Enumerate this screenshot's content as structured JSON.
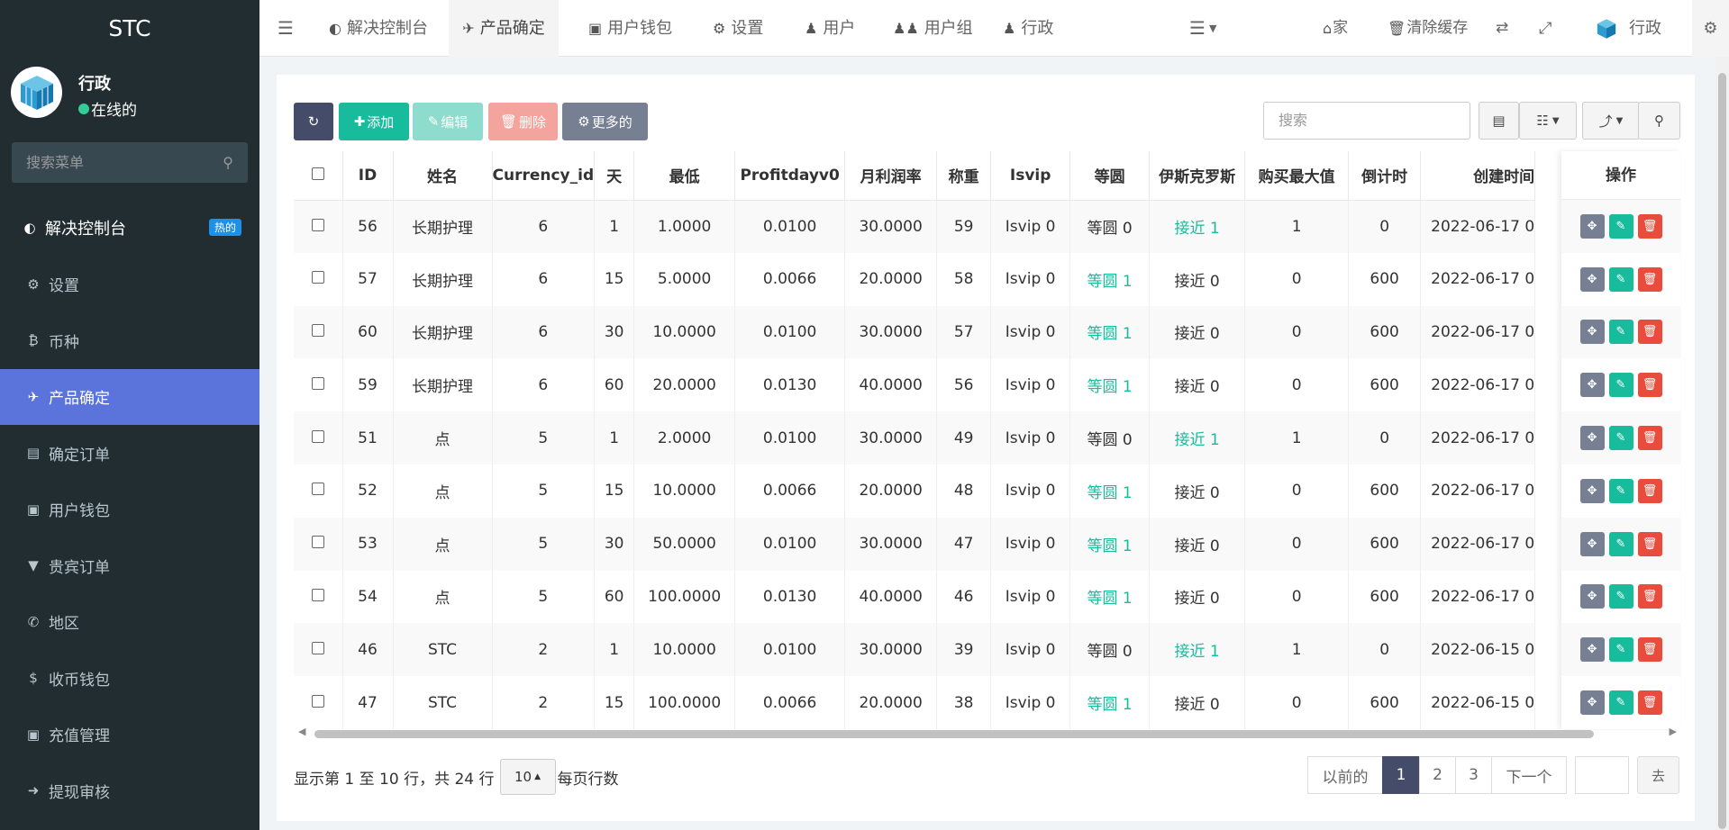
{
  "app": {
    "logo": "STC",
    "user_name": "行政",
    "user_status": "在线的",
    "search_placeholder": "搜索菜单"
  },
  "sidebar": {
    "items": [
      {
        "label": "解决控制台",
        "icon": "dashboard-icon",
        "badge": "热的"
      },
      {
        "label": "设置",
        "icon": "gear-icon"
      },
      {
        "label": "币种",
        "icon": "bitcoin-icon"
      },
      {
        "label": "产品确定",
        "icon": "plane-icon",
        "active": true
      },
      {
        "label": "确定订单",
        "icon": "book-icon"
      },
      {
        "label": "用户钱包",
        "icon": "money-icon"
      },
      {
        "label": "贵宾订单",
        "icon": "chevron-circle-icon"
      },
      {
        "label": "地区",
        "icon": "phone-square-icon"
      },
      {
        "label": "收币钱包",
        "icon": "dollar-icon"
      },
      {
        "label": "充值管理",
        "icon": "money-icon"
      },
      {
        "label": "提现审核",
        "icon": "arrow-circle-icon"
      }
    ]
  },
  "header": {
    "tabs": [
      {
        "label": "解决控制台",
        "icon": "dashboard-icon"
      },
      {
        "label": "产品确定",
        "icon": "plane-icon"
      },
      {
        "label": "用户钱包",
        "icon": "money-icon"
      },
      {
        "label": "设置",
        "icon": "gear-icon"
      },
      {
        "label": "用户",
        "icon": "user-icon"
      },
      {
        "label": "用户组",
        "icon": "users-icon"
      },
      {
        "label": "行政",
        "icon": "user-icon"
      }
    ],
    "home": "家",
    "clear_cache": "清除缓存",
    "admin": "行政"
  },
  "toolbar": {
    "add": "添加",
    "edit": "编辑",
    "delete": "删除",
    "more": "更多的",
    "search_placeholder": "搜索"
  },
  "table": {
    "columns": [
      "ID",
      "姓名",
      "Currency_id",
      "天",
      "最低",
      "Profitdayv0",
      "月利润率",
      "称重",
      "Isvip",
      "等圆",
      "伊斯克罗斯",
      "购买最大值",
      "倒计时",
      "创建时间",
      "操作"
    ],
    "rows": [
      {
        "id": "56",
        "name": "长期护理",
        "cur": "6",
        "day": "1",
        "min": "1.0000",
        "pd": "0.0100",
        "mr": "30.0000",
        "w": "59",
        "vip": "Isvip 0",
        "dy": "等圆 0",
        "ys": "接近 1",
        "max": "1",
        "cd": "0",
        "ct": "2022-06-17 0"
      },
      {
        "id": "57",
        "name": "长期护理",
        "cur": "6",
        "day": "15",
        "min": "5.0000",
        "pd": "0.0066",
        "mr": "20.0000",
        "w": "58",
        "vip": "Isvip 0",
        "dy": "等圆 1",
        "ys": "接近 0",
        "max": "0",
        "cd": "600",
        "ct": "2022-06-17 0"
      },
      {
        "id": "60",
        "name": "长期护理",
        "cur": "6",
        "day": "30",
        "min": "10.0000",
        "pd": "0.0100",
        "mr": "30.0000",
        "w": "57",
        "vip": "Isvip 0",
        "dy": "等圆 1",
        "ys": "接近 0",
        "max": "0",
        "cd": "600",
        "ct": "2022-06-17 0"
      },
      {
        "id": "59",
        "name": "长期护理",
        "cur": "6",
        "day": "60",
        "min": "20.0000",
        "pd": "0.0130",
        "mr": "40.0000",
        "w": "56",
        "vip": "Isvip 0",
        "dy": "等圆 1",
        "ys": "接近 0",
        "max": "0",
        "cd": "600",
        "ct": "2022-06-17 0"
      },
      {
        "id": "51",
        "name": "点",
        "cur": "5",
        "day": "1",
        "min": "2.0000",
        "pd": "0.0100",
        "mr": "30.0000",
        "w": "49",
        "vip": "Isvip 0",
        "dy": "等圆 0",
        "ys": "接近 1",
        "max": "1",
        "cd": "0",
        "ct": "2022-06-17 0"
      },
      {
        "id": "52",
        "name": "点",
        "cur": "5",
        "day": "15",
        "min": "10.0000",
        "pd": "0.0066",
        "mr": "20.0000",
        "w": "48",
        "vip": "Isvip 0",
        "dy": "等圆 1",
        "ys": "接近 0",
        "max": "0",
        "cd": "600",
        "ct": "2022-06-17 0"
      },
      {
        "id": "53",
        "name": "点",
        "cur": "5",
        "day": "30",
        "min": "50.0000",
        "pd": "0.0100",
        "mr": "30.0000",
        "w": "47",
        "vip": "Isvip 0",
        "dy": "等圆 1",
        "ys": "接近 0",
        "max": "0",
        "cd": "600",
        "ct": "2022-06-17 0"
      },
      {
        "id": "54",
        "name": "点",
        "cur": "5",
        "day": "60",
        "min": "100.0000",
        "pd": "0.0130",
        "mr": "40.0000",
        "w": "46",
        "vip": "Isvip 0",
        "dy": "等圆 1",
        "ys": "接近 0",
        "max": "0",
        "cd": "600",
        "ct": "2022-06-17 0"
      },
      {
        "id": "46",
        "name": "STC",
        "cur": "2",
        "day": "1",
        "min": "10.0000",
        "pd": "0.0100",
        "mr": "30.0000",
        "w": "39",
        "vip": "Isvip 0",
        "dy": "等圆 0",
        "ys": "接近 1",
        "max": "1",
        "cd": "0",
        "ct": "2022-06-15 0"
      },
      {
        "id": "47",
        "name": "STC",
        "cur": "2",
        "day": "15",
        "min": "100.0000",
        "pd": "0.0066",
        "mr": "20.0000",
        "w": "38",
        "vip": "Isvip 0",
        "dy": "等圆 1",
        "ys": "接近 0",
        "max": "0",
        "cd": "600",
        "ct": "2022-06-15 0"
      }
    ]
  },
  "footer": {
    "info_prefix": "显示第 1 至 10 行，共 24 行",
    "page_size": "10",
    "per_page": "每页行数",
    "prev": "以前的",
    "pages": [
      "1",
      "2",
      "3"
    ],
    "next": "下一个",
    "go": "去"
  },
  "colors": {
    "sidebar_bg": "#222d32",
    "active": "#5b74dc",
    "green": "#18bc9c",
    "red": "#e74c3c",
    "primary_dark": "#444c69"
  }
}
